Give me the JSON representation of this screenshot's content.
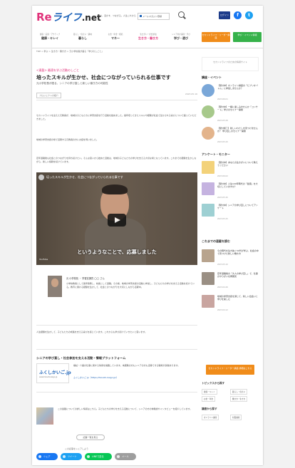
{
  "header": {
    "logo_re": "Re",
    "logo_life": "ライフ",
    "logo_net": ".net",
    "tagline": "学ぶ、活かす、つながる。人生これから",
    "mail_btn": "メールマガジン登録",
    "login": "ログイン",
    "fb": "f",
    "tw": "t"
  },
  "nav": {
    "items": [
      {
        "sub": "健康・美容・アクティブ",
        "label": "健康・キレイ"
      },
      {
        "sub": "暮らし・住まい・趣味",
        "label": "暮らし"
      },
      {
        "sub": "お金・年金・相続",
        "label": "マネー"
      },
      {
        "sub": "生きがい・社会参加",
        "label": "生き方・働き方"
      },
      {
        "sub": "シニア向け講座・学び",
        "label": "学び・遊び"
      }
    ],
    "btn_orange": "セカンドライフ・リーダー講座",
    "btn_green": "学び・イベント情報"
  },
  "breadcrumb": "TOP > 学ぶ > 生き方・働き方 > 元小学校長が語る「学びのしごと」",
  "article": {
    "category": "<連載> 最適を学ぶ活動のしごと",
    "title": "培ったスキルが生かせ、社会につながっていられる仕事です",
    "subtitle": "元小学校長が語る、シニアの学び直しと新しい働き方の可能性",
    "tag": "プロジェクトの紹介",
    "date": "2023.05.16",
    "para1": "セカンドライフを迎えた元教員が、地域の子どもたちに学習支援を行う活動を始めました。長年培ってきたスキルや経験が社会で生かされる喜びについて語っていただきました。",
    "para2": "地域の学習支援の場で活躍する元教員の方にお話を伺いました。",
    "para3": "定年退職後も社会とのつながりを持ち続けたい。そんな思いから始めた活動は、地域の子どもたちの学びを支える大切な場となっています。これまでの経験を生かしながら、新しい挑戦を続けています。"
  },
  "video": {
    "title": "培ったスキルが生かせ、社会につながっていられる仕事です",
    "caption": "というようなことで、応募しました",
    "yt": "YouTube"
  },
  "profile": {
    "name": "元 小学校長 ・ 学習支援員 ◯◯ さん",
    "text": "小学校教員として長年勤務し、校長として退職。その後、地域の学習支援の活動に参加し、子どもたちの学びを支える活動を続けている。教育に関わる経験を生かして、社会とのつながりを大切にしながら活躍中。"
  },
  "quote": "人生経験を生かして、子どもたちの成長を支える喜びを感じています。これからも学び続けていきたいと思います。",
  "section": {
    "title": "シニアの学び直し・社会参加を支える活動・情報プラットフォーム",
    "logo1": "ふくしかいご.jp",
    "logo2": "www.fukushi-kaigo.jp",
    "text": "福祉・介護の仕事に関する情報を掲載しています。未経験の方もシニアの方も活躍できる職場が多数あります。",
    "link": "ふくしかいご.jp（https://fukushi-kaigo.jp/）"
  },
  "related": {
    "text": "この連載についての詳しい情報はこちら。子どもたちの学びを支える活動について、シニアの方の体験談やインタビューを紹介しています。",
    "more": "記事一覧を見る"
  },
  "share": {
    "label": "この記事をシェアしよう",
    "fb": "シェア",
    "tw": "ツイート",
    "line": "LINEで送る",
    "mail": "メール"
  },
  "sidebar": {
    "banner": "セカンドライフのための情報サイト",
    "heading1": "講座・イベント",
    "items1": [
      {
        "title": "【受付中】オンライン講座の「ビブリオバトル」に参加しませんか？",
        "date": "2023.06.01"
      },
      {
        "title": "【受付中】一緒に楽しみませんか「コンサート」学びのセミナー開催",
        "date": "2023.05.28"
      },
      {
        "title": "【受付終了】新しいわたしを見つけませんか？ 学び直しのセミナー開催",
        "date": "2023.05.20"
      }
    ],
    "heading2": "アンケート・モニター",
    "items2": [
      {
        "title": "【受付中】あなたの生きがいについて教えてください",
        "date": "2023.06.02"
      },
      {
        "title": "【受付中】人生100年時代の「健康」を大切にしていますか？",
        "date": "2023.05.30"
      },
      {
        "title": "【受付中】シニアの学び直しについてアンケート",
        "date": "2023.05.25"
      }
    ],
    "heading3": "これまでの連載を読む",
    "items3": [
      {
        "title": "今の時代を生き抜く50代が学ぶ、社会の中で見つけた新しい働き方",
        "date": "2023.05.10"
      },
      {
        "title": "定年退職後の「大人の学び直し」で、仕事のやりがいを再発見",
        "date": "2023.04.26"
      },
      {
        "title": "地域の学習支援を通じて、新しい出会いと学びを楽しむ",
        "date": "2023.04.12"
      }
    ],
    "side_btn": "セカンドライフ・リーダー講座 詳細はこちら",
    "kw_title1": "トピックスから探す",
    "kw1": [
      "健康・キレイ",
      "暮らし・住まい",
      "お金・年金",
      "働き方・生き方"
    ],
    "kw_title2": "講座から探す",
    "kw2": [
      "オンライン講座",
      "対面講座"
    ]
  }
}
